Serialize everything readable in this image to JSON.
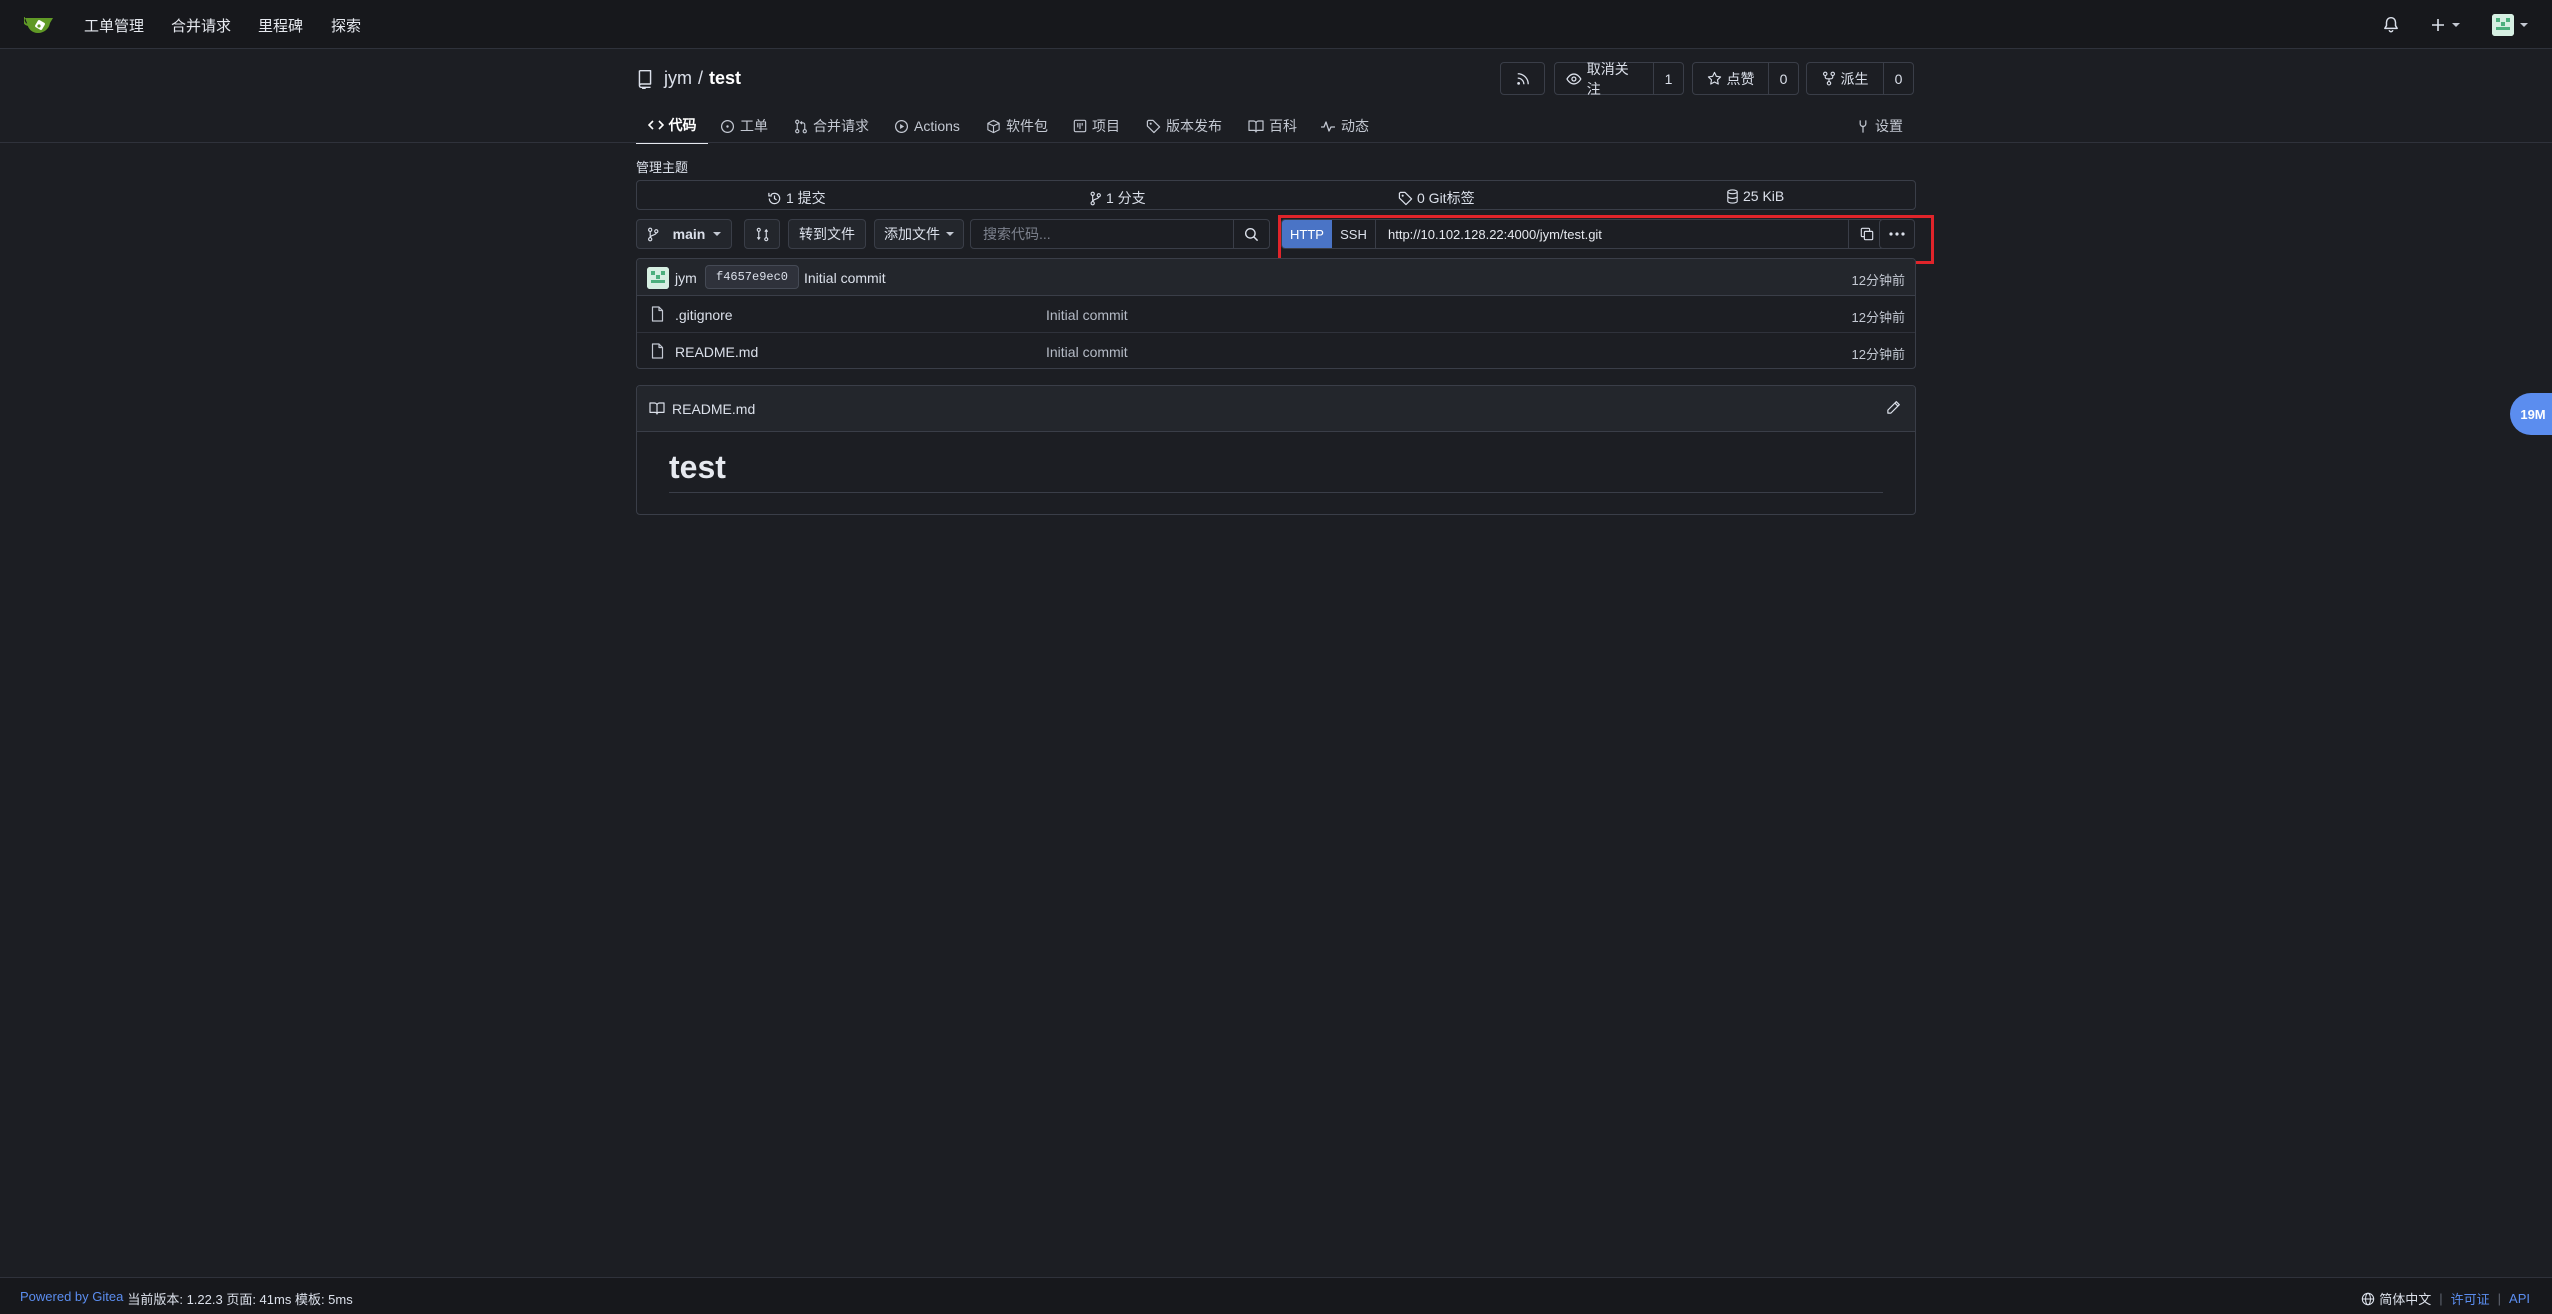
{
  "nav": {
    "items": [
      "工单管理",
      "合并请求",
      "里程碑",
      "探索"
    ]
  },
  "repo": {
    "owner": "jym",
    "separator": "/",
    "name": "test",
    "unwatch_label": "取消关注",
    "watch_count": "1",
    "star_label": "点赞",
    "star_count": "0",
    "fork_label": "派生",
    "fork_count": "0"
  },
  "tabs": [
    {
      "label": "代码",
      "icon": "code-icon",
      "active": true
    },
    {
      "label": "工单",
      "icon": "issue-icon"
    },
    {
      "label": "合并请求",
      "icon": "pull-request-icon"
    },
    {
      "label": "Actions",
      "icon": "play-icon"
    },
    {
      "label": "软件包",
      "icon": "package-icon"
    },
    {
      "label": "项目",
      "icon": "project-icon"
    },
    {
      "label": "版本发布",
      "icon": "tag-icon"
    },
    {
      "label": "百科",
      "icon": "book-icon"
    },
    {
      "label": "动态",
      "icon": "pulse-icon"
    }
  ],
  "settings_label": "设置",
  "topic_label": "管理主题",
  "stats": {
    "commits": "1 提交",
    "branches": "1 分支",
    "tags": "0 Git标签",
    "size": "25 KiB"
  },
  "toolbar": {
    "branch": "main",
    "goto_file": "转到文件",
    "add_file": "添加文件",
    "search_placeholder": "搜索代码..."
  },
  "clone": {
    "http_label": "HTTP",
    "ssh_label": "SSH",
    "url": "http://10.102.128.22:4000/jym/test.git"
  },
  "latest_commit": {
    "author": "jym",
    "sha": "f4657e9ec0",
    "message": "Initial commit",
    "time": "12分钟前"
  },
  "files": [
    {
      "name": ".gitignore",
      "message": "Initial commit",
      "time": "12分钟前"
    },
    {
      "name": "README.md",
      "message": "Initial commit",
      "time": "12分钟前"
    }
  ],
  "readme": {
    "filename": "README.md",
    "heading": "test"
  },
  "badge": "19M",
  "footer": {
    "powered": "Powered by Gitea",
    "version": "当前版本: 1.22.3 页面: 41ms 模板: 5ms",
    "language": "简体中文",
    "license": "许可证",
    "api": "API"
  },
  "colors": {
    "background": "#1c1e23",
    "accent": "#4a74c6",
    "highlight": "#e0242a",
    "link": "#5b8def"
  }
}
